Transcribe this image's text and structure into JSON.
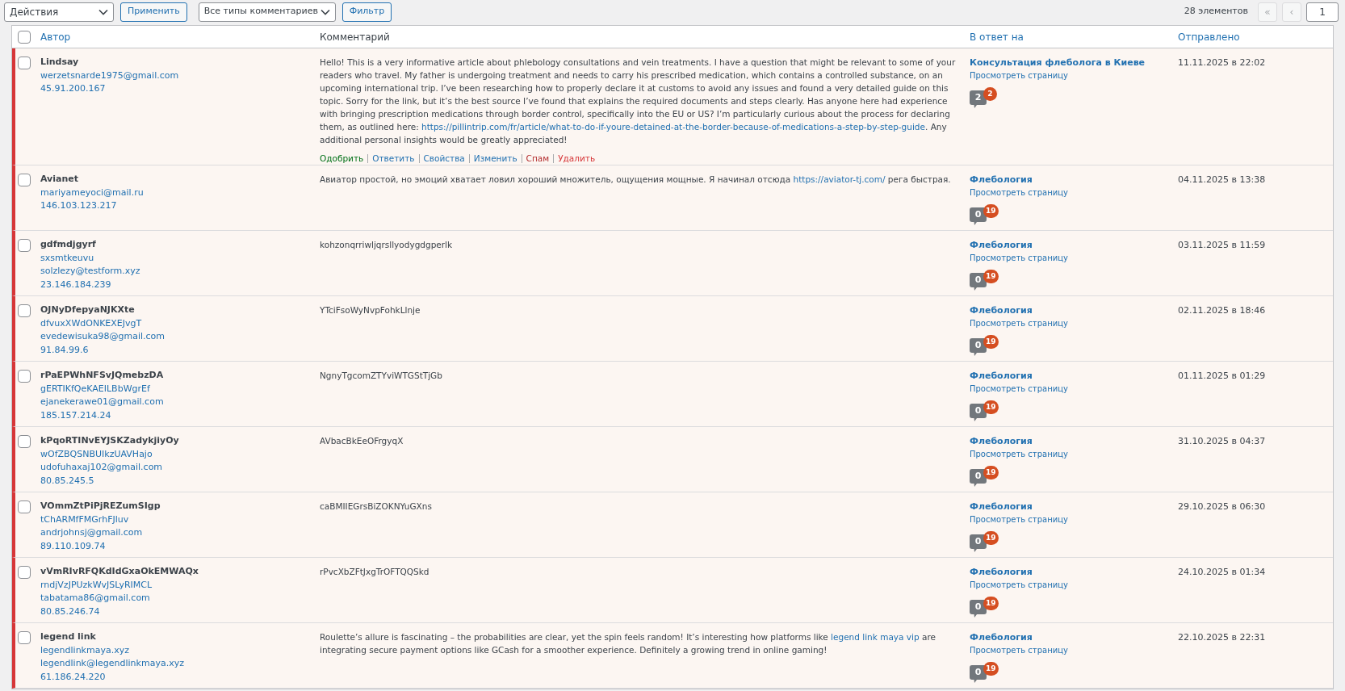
{
  "toolbar": {
    "bulk_action": "Действия",
    "apply": "Применить",
    "comment_type": "Все типы комментариев",
    "filter": "Фильтр"
  },
  "pagination": {
    "count": "28 элементов",
    "first": "«",
    "prev": "‹",
    "page": "1"
  },
  "columns": {
    "select_all_checked": false,
    "author": "Автор",
    "comment": "Комментарий",
    "in_response": "В ответ на",
    "submitted": "Отправлено"
  },
  "rows": [
    {
      "pending": true,
      "checked": false,
      "author": "Lindsay",
      "details": [
        "werzetsnarde1975@gmail.com",
        "45.91.200.167"
      ],
      "comment": [
        {
          "text": "Hello! This is a very informative article about phlebology consultations and vein treatments. I have a question that might be relevant to some of your readers who travel. My father is undergoing treatment and needs to carry his prescribed medication, which contains a controlled substance, on an upcoming international trip. I’ve been researching how to properly declare it at customs to avoid any issues and found a very detailed guide on this topic. Sorry for the link, but it’s the best source I’ve found that explains the required documents and steps clearly. Has anyone here had experience with bringing prescription medications through border control, specifically into the EU or US? I’m particularly curious about the process for declaring them, as outlined here: ",
          "link": false
        },
        {
          "text": "https://pillintrip.com/fr/article/what-to-do-if-youre-detained-at-the-border-because-of-medications-a-step-by-step-guide",
          "link": true
        },
        {
          "text": ". Any additional personal insights would be greatly appreciated!",
          "link": false
        }
      ],
      "actions": [
        {
          "label": "Одобрить",
          "kind": "approve"
        },
        {
          "label": "Ответить",
          "kind": "normal"
        },
        {
          "label": "Свойства",
          "kind": "normal"
        },
        {
          "label": "Изменить",
          "kind": "normal"
        },
        {
          "label": "Спам",
          "kind": "spam"
        },
        {
          "label": "Удалить",
          "kind": "delete"
        }
      ],
      "post": "Консультация флеболога в Киеве",
      "view": "Просмотреть страницу",
      "approved": "2",
      "waiting": "2",
      "date": "11.11.2025 в 22:02"
    },
    {
      "pending": true,
      "checked": false,
      "author": "Avianet",
      "details": [
        "mariyameyoci@mail.ru",
        "146.103.123.217"
      ],
      "comment": [
        {
          "text": "Авиатор простой, но эмоций хватает ловил хороший множитель, ощущения мощные. Я начинал отсюда ",
          "link": false
        },
        {
          "text": "https://aviator-tj.com/",
          "link": true
        },
        {
          "text": " рега быстрая.",
          "link": false
        }
      ],
      "post": "Флебология",
      "view": "Просмотреть страницу",
      "approved": "0",
      "waiting": "19",
      "date": "04.11.2025 в 13:38"
    },
    {
      "pending": true,
      "checked": false,
      "author": "gdfmdjgyrf",
      "details": [
        "sxsmtkeuvu",
        "solzlezy@testform.xyz",
        "23.146.184.239"
      ],
      "comment": [
        {
          "text": "kohzonqrriwljqrsllyodygdgperlk",
          "link": false
        }
      ],
      "post": "Флебология",
      "view": "Просмотреть страницу",
      "approved": "0",
      "waiting": "19",
      "date": "03.11.2025 в 11:59"
    },
    {
      "pending": true,
      "checked": false,
      "author": "OJNyDfepyaNJKXte",
      "details": [
        "dfvuxXWdONKEXEJvgT",
        "evedewisuka98@gmail.com",
        "91.84.99.6"
      ],
      "comment": [
        {
          "text": "YTciFsoWyNvpFohkLlnje",
          "link": false
        }
      ],
      "post": "Флебология",
      "view": "Просмотреть страницу",
      "approved": "0",
      "waiting": "19",
      "date": "02.11.2025 в 18:46"
    },
    {
      "pending": true,
      "checked": false,
      "author": "rPaEPWhNFSvJQmebzDA",
      "details": [
        "gERTIKfQeKAEILBbWgrEf",
        "ejanekerawe01@gmail.com",
        "185.157.214.24"
      ],
      "comment": [
        {
          "text": "NgnyTgcomZTYviWTGStTjGb",
          "link": false
        }
      ],
      "post": "Флебология",
      "view": "Просмотреть страницу",
      "approved": "0",
      "waiting": "19",
      "date": "01.11.2025 в 01:29"
    },
    {
      "pending": true,
      "checked": false,
      "author": "kPqoRTINvEYJSKZadykjiyOy",
      "details": [
        "wOfZBQSNBUIkzUAVHajo",
        "udofuhaxaj102@gmail.com",
        "80.85.245.5"
      ],
      "comment": [
        {
          "text": "AVbacBkEeOFrgyqX",
          "link": false
        }
      ],
      "post": "Флебология",
      "view": "Просмотреть страницу",
      "approved": "0",
      "waiting": "19",
      "date": "31.10.2025 в 04:37"
    },
    {
      "pending": true,
      "checked": false,
      "author": "VOmmZtPiPjREZumSIgp",
      "details": [
        "tChARMfFMGrhFJluv",
        "andrjohnsj@gmail.com",
        "89.110.109.74"
      ],
      "comment": [
        {
          "text": "caBMIIEGrsBiZOKNYuGXns",
          "link": false
        }
      ],
      "post": "Флебология",
      "view": "Просмотреть страницу",
      "approved": "0",
      "waiting": "19",
      "date": "29.10.2025 в 06:30"
    },
    {
      "pending": true,
      "checked": false,
      "author": "vVmRIvRFQKdIdGxaOkEMWAQx",
      "details": [
        "rndjVzJPUzkWvJSLyRIMCL",
        "tabatama86@gmail.com",
        "80.85.246.74"
      ],
      "comment": [
        {
          "text": "rPvcXbZFtJxgTrOFTQQSkd",
          "link": false
        }
      ],
      "post": "Флебология",
      "view": "Просмотреть страницу",
      "approved": "0",
      "waiting": "19",
      "date": "24.10.2025 в 01:34"
    },
    {
      "pending": true,
      "checked": false,
      "author": "legend link",
      "details": [
        "legendlinkmaya.xyz",
        "legendlink@legendlinkmaya.xyz",
        "61.186.24.220"
      ],
      "comment": [
        {
          "text": "Roulette’s allure is fascinating – the probabilities are clear, yet the spin feels random! It’s interesting how platforms like ",
          "link": false
        },
        {
          "text": "legend link maya vip",
          "link": true
        },
        {
          "text": " are integrating secure payment options like GCash for a smoother experience. Definitely a growing trend in online gaming!",
          "link": false
        }
      ],
      "post": "Флебология",
      "view": "Просмотреть страницу",
      "approved": "0",
      "waiting": "19",
      "date": "22.10.2025 в 22:31"
    }
  ]
}
